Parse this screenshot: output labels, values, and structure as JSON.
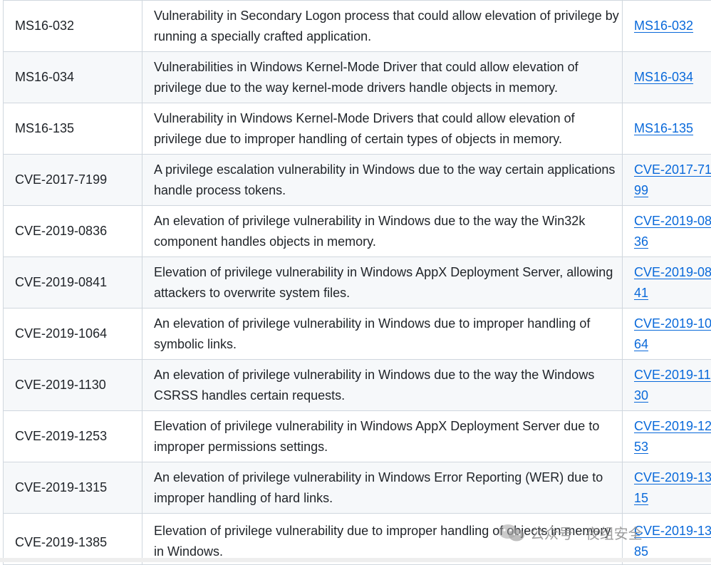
{
  "rows": [
    {
      "id": "MS16-032",
      "desc": "Vulnerability in Secondary Logon process that could allow elevation of privilege by running a specially crafted application.",
      "ref": "MS16-032"
    },
    {
      "id": "MS16-034",
      "desc": "Vulnerabilities in Windows Kernel-Mode Driver that could allow elevation of privilege due to the way kernel-mode drivers handle objects in memory.",
      "ref": "MS16-034"
    },
    {
      "id": "MS16-135",
      "desc": "Vulnerability in Windows Kernel-Mode Drivers that could allow elevation of privilege due to improper handling of certain types of objects in memory.",
      "ref": "MS16-135"
    },
    {
      "id": "CVE-2017-7199",
      "desc": "A privilege escalation vulnerability in Windows due to the way certain applications handle process tokens.",
      "ref": "CVE-2017-7199"
    },
    {
      "id": "CVE-2019-0836",
      "desc": "An elevation of privilege vulnerability in Windows due to the way the Win32k component handles objects in memory.",
      "ref": "CVE-2019-0836"
    },
    {
      "id": "CVE-2019-0841",
      "desc": "Elevation of privilege vulnerability in Windows AppX Deployment Server, allowing attackers to overwrite system files.",
      "ref": "CVE-2019-0841"
    },
    {
      "id": "CVE-2019-1064",
      "desc": "An elevation of privilege vulnerability in Windows due to improper handling of symbolic links.",
      "ref": "CVE-2019-1064"
    },
    {
      "id": "CVE-2019-1130",
      "desc": "An elevation of privilege vulnerability in Windows due to the way the Windows CSRSS handles certain requests.",
      "ref": "CVE-2019-1130"
    },
    {
      "id": "CVE-2019-1253",
      "desc": "Elevation of privilege vulnerability in Windows AppX Deployment Server due to improper permissions settings.",
      "ref": "CVE-2019-1253"
    },
    {
      "id": "CVE-2019-1315",
      "desc": "An elevation of privilege vulnerability in Windows Error Reporting (WER) due to improper handling of hard links.",
      "ref": "CVE-2019-1315"
    },
    {
      "id": "CVE-2019-1385",
      "desc": "Elevation of privilege vulnerability due to improper handling of objects in memory in Windows.",
      "ref": "CVE-2019-1385"
    }
  ],
  "watermark": {
    "text": "公众号 · 夜组安全"
  },
  "colors": {
    "link": "#0969da",
    "border": "#d0d7de",
    "alt_row": "#f6f8fa",
    "text": "#1f2328"
  }
}
